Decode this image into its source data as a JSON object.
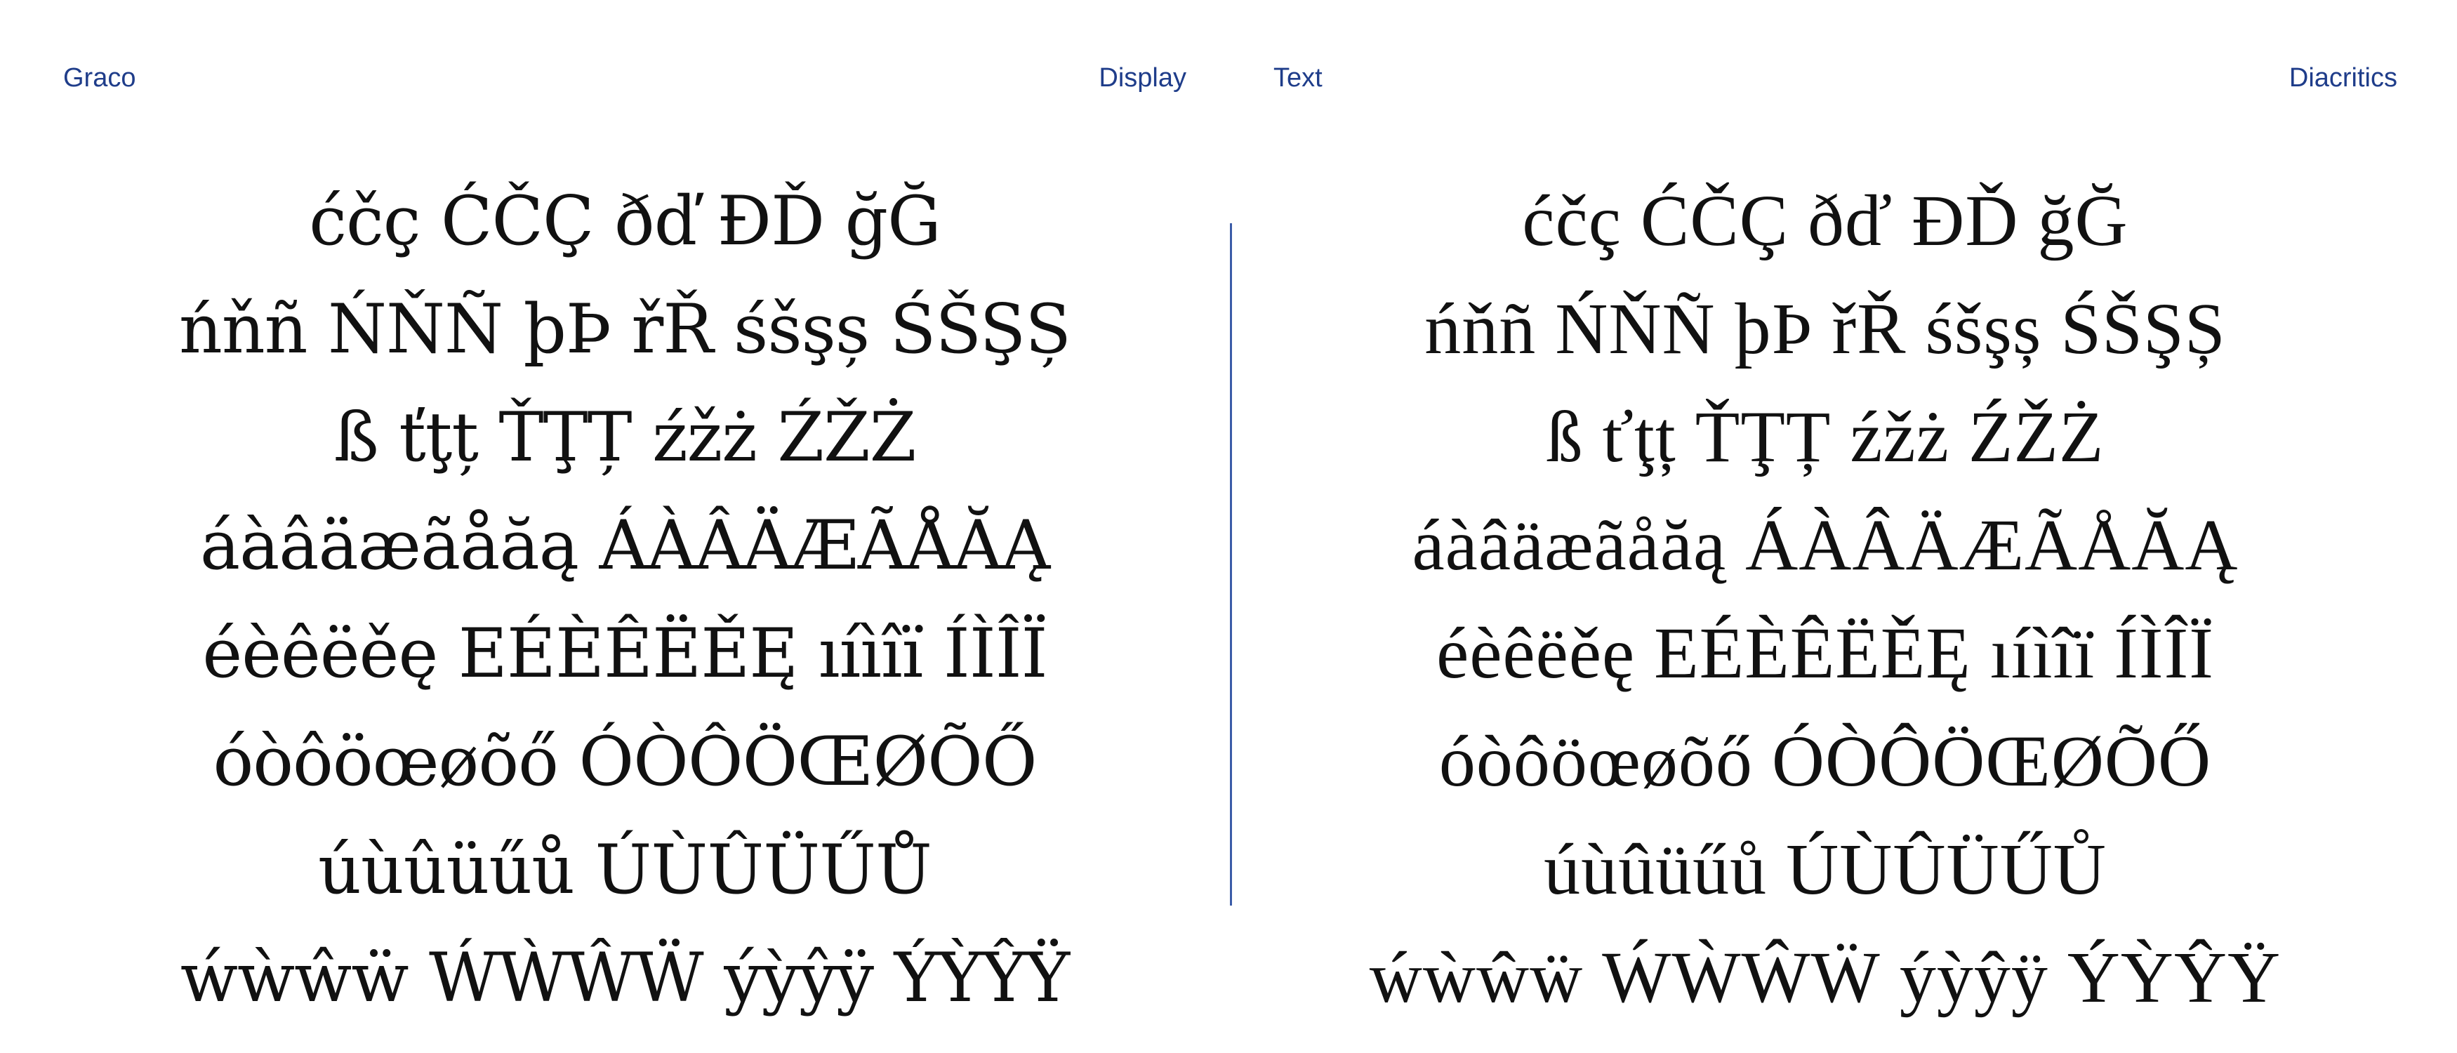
{
  "header": {
    "left_title": "Graco",
    "left_subtitle": "Display",
    "right_title": "Text",
    "right_subtitle": "Diacritics"
  },
  "display_panel": {
    "lines": [
      "ćčç ĆČÇ ðď ĐĎ ğĞ",
      "ńňñ ŃŇÑ þÞ řŘ śšşș ŚŠŞȘ",
      "ß ťţț ŤŢȚ źžż ŹŽŻ",
      "áàâäæãåăą ÁÀÂÄÆÃÅĂĄ",
      "éèêëěę EÉÈÊËĚĘ ıíìîï ÍÌÎÏ",
      "óòôöœøõő ÓÒÔÖŒØÕŐ",
      "úùûüűů ÚÙÛÜŰŮ",
      "ẃẁŵẅ ẂẀŴẄ ýỳŷÿ ÝỲŶŸ"
    ]
  },
  "text_panel": {
    "lines": [
      "ćčç ĆČÇ ðď ĐĎ ğĞ",
      "ńňñ ŃŇÑ þÞ řŘ śšşș ŚŠŞȘ",
      "ß ťţț ŤŢȚ źžż ŹŽŻ",
      "áàâäæãåăą ÁÀÂÄÆÃÅĂĄ",
      "éèêëěę EÉÈÊËĚĘ ıíìîï ÍÌÎÏ",
      "óòôöœøõő ÓÒÔÖŒØÕŐ",
      "úùûüűů ÚÙÛÜŰŮ",
      "ẃẁŵẅ ẂẀŴẄ ýỳŷÿ ÝỲŶŸ"
    ]
  },
  "colors": {
    "accent": "#1f3d8a",
    "divider": "#3b5ca8",
    "text": "#111111",
    "background": "#ffffff"
  }
}
